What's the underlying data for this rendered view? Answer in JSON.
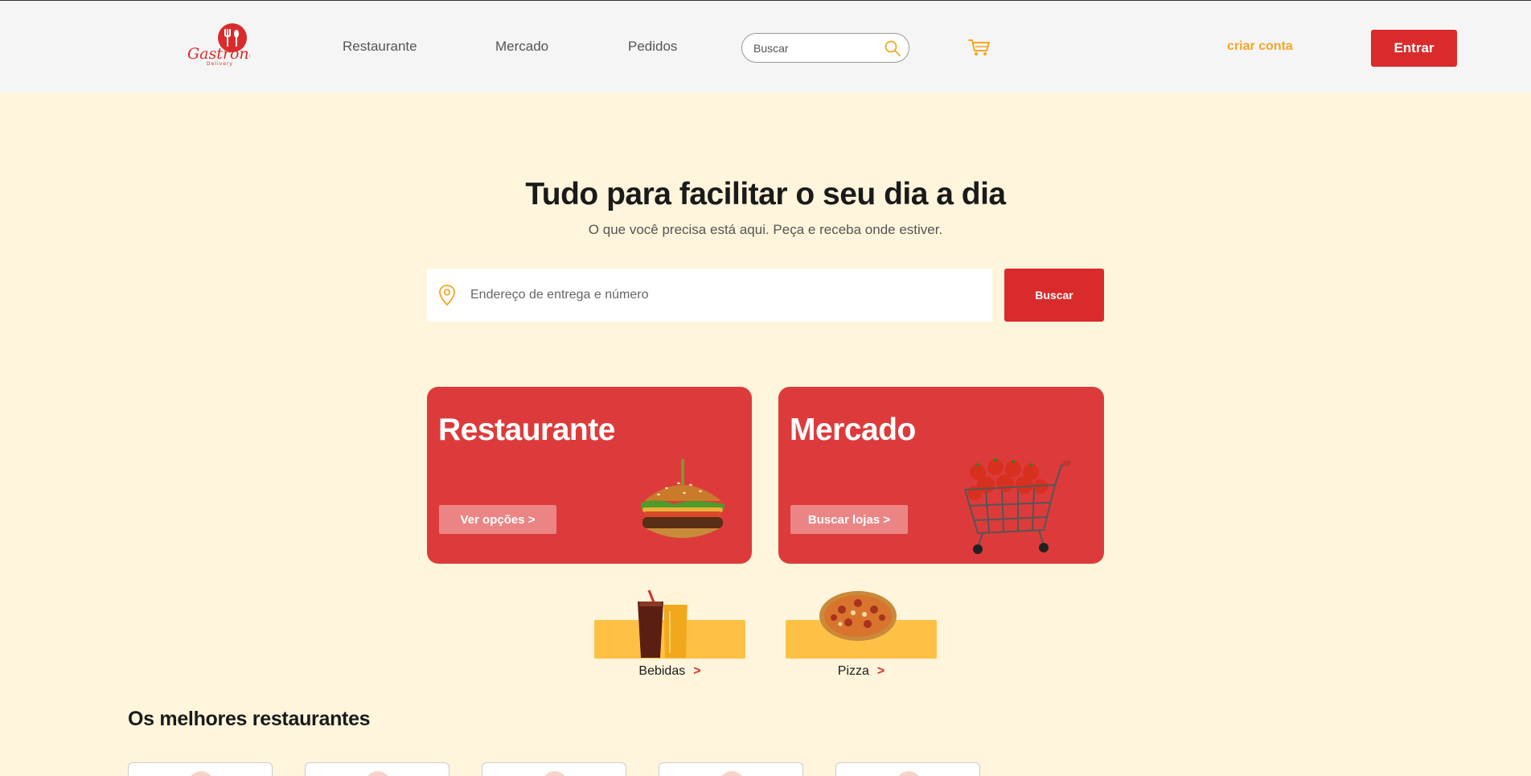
{
  "header": {
    "logo_text": "Gastronelle",
    "logo_subtext": "Delivery",
    "nav": {
      "restaurante": "Restaurante",
      "mercado": "Mercado",
      "pedidos": "Pedidos"
    },
    "search_placeholder": "Buscar",
    "criar_conta": "criar conta",
    "entrar": "Entrar"
  },
  "hero": {
    "title": "Tudo para facilitar o seu dia a dia",
    "subtitle": "O que você precisa está aqui. Peça e receba onde estiver.",
    "address_placeholder": "Endereço de entrega e número",
    "buscar": "Buscar"
  },
  "cards": {
    "restaurante": {
      "title": "Restaurante",
      "button": "Ver opções >"
    },
    "mercado": {
      "title": "Mercado",
      "button": "Buscar lojas >"
    }
  },
  "mini_categories": {
    "bebidas": {
      "label": "Bebidas",
      "arrow": ">"
    },
    "pizza": {
      "label": "Pizza",
      "arrow": ">"
    }
  },
  "section": {
    "best_restaurants": "Os melhores restaurantes"
  },
  "colors": {
    "brand_red": "#D92B2B",
    "card_red": "#DD3B3B",
    "accent_yellow": "#FFC145",
    "accent_orange": "#F5A623",
    "background": "#FFF5DC"
  }
}
